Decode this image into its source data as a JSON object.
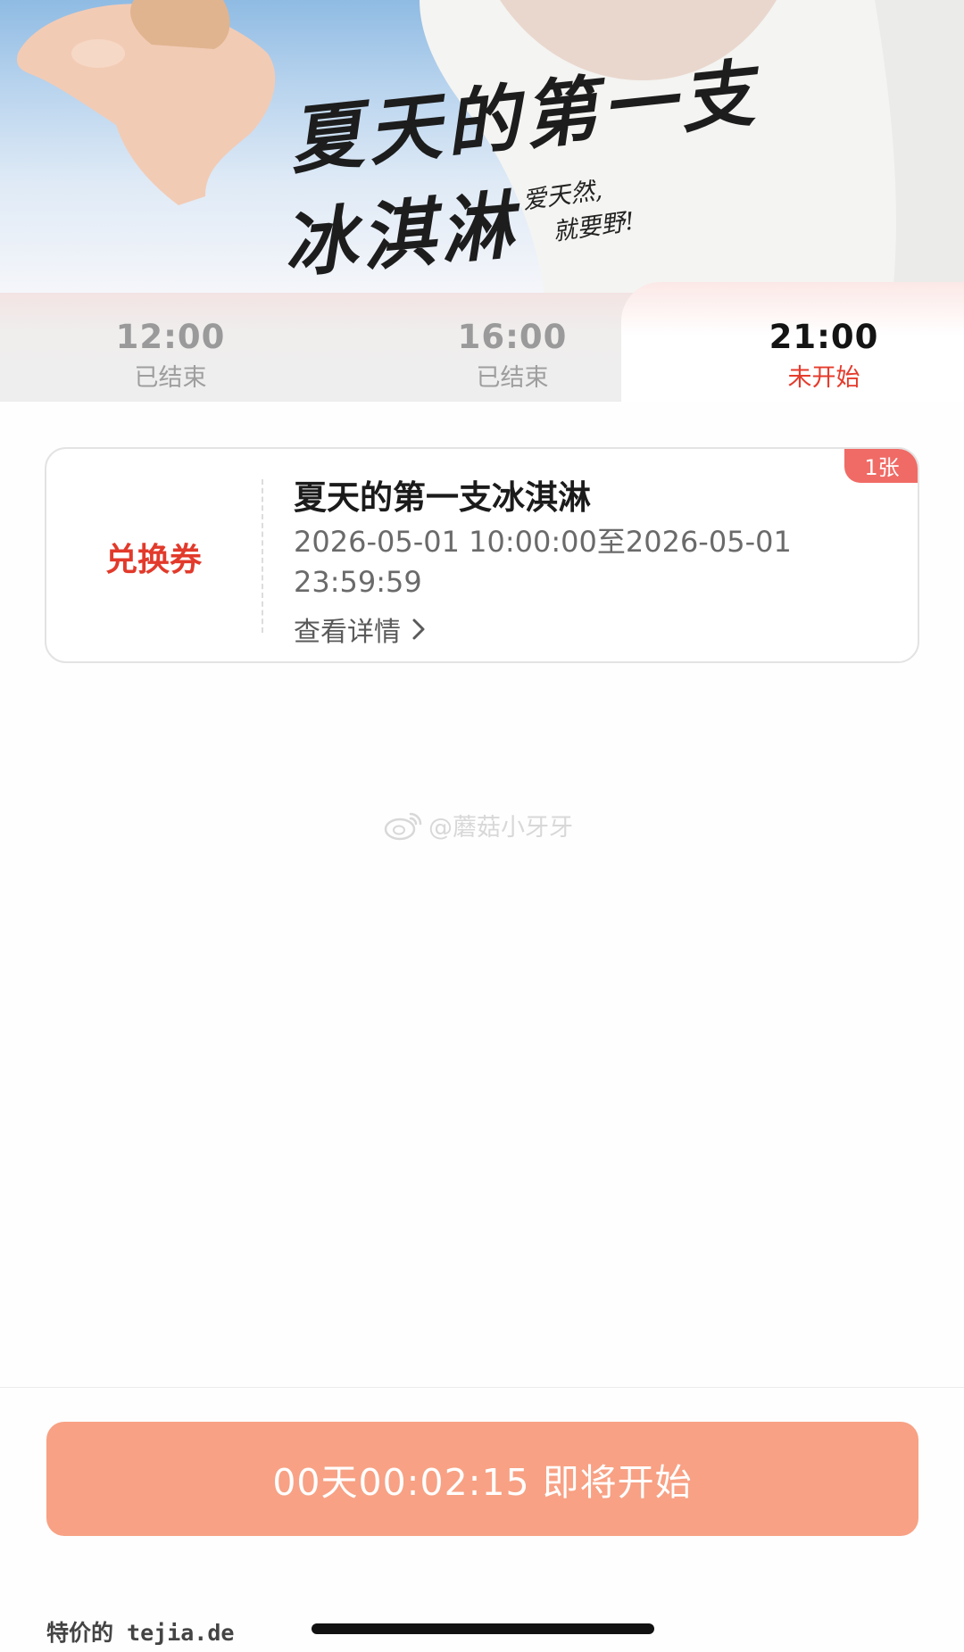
{
  "banner": {
    "headline_line1": "夏天的第一支",
    "headline_line2": "冰淇淋",
    "slogan_line1": "爱天然,",
    "slogan_line2": "就要野!"
  },
  "tabs": [
    {
      "time": "12:00",
      "state": "已结束",
      "active": false
    },
    {
      "time": "16:00",
      "state": "已结束",
      "active": false
    },
    {
      "time": "21:00",
      "state": "未开始",
      "active": true
    }
  ],
  "coupon": {
    "type_label": "兑换券",
    "title": "夏天的第一支冰淇淋",
    "valid_period": "2026-05-01 10:00:00至2026-05-01 23:59:59",
    "detail_link": "查看详情",
    "badge": "1张"
  },
  "watermark": {
    "text": "@蘑菇小牙牙"
  },
  "bottom": {
    "countdown_text": "00天00:02:15 即将开始",
    "site_mark": "特价的 tejia.de"
  },
  "colors": {
    "accent_red": "#e53b2c",
    "button": "#f8a184",
    "badge": "#f06b66"
  }
}
